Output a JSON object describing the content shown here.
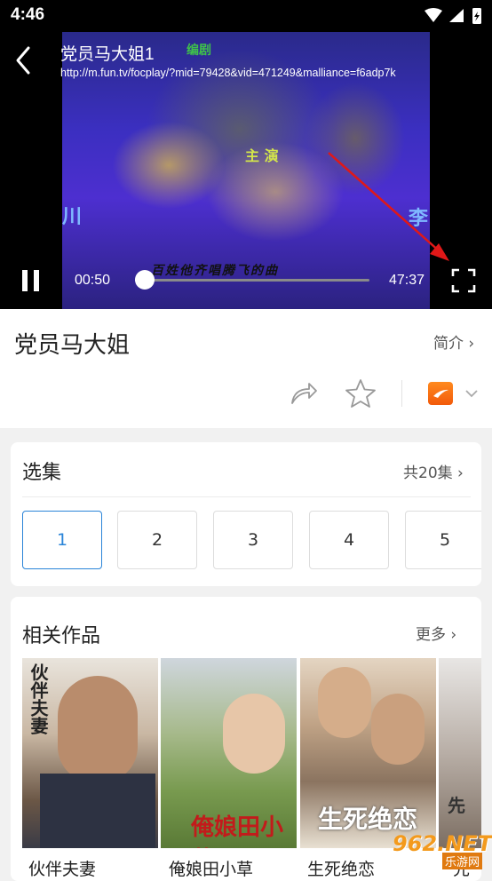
{
  "status": {
    "time": "4:46"
  },
  "player": {
    "title": "党员马大姐1",
    "url": "http://m.fun.tv/focplay/?mid=79428&vid=471249&malliance=f6adp7k",
    "current_time": "00:50",
    "total_time": "47:37",
    "progress_fraction": 0.018,
    "frame_texts": {
      "lead": "主 演",
      "subtitle": "百姓他齐唱腾飞的曲",
      "left_glyph": "川",
      "right_glyph": "李",
      "top_glyph": "编剧"
    }
  },
  "info": {
    "title": "党员马大姐",
    "intro_label": "简介 ›"
  },
  "episodes": {
    "label": "选集",
    "count_label": "共20集 ›",
    "items": [
      "1",
      "2",
      "3",
      "4",
      "5"
    ],
    "active_index": 0
  },
  "related": {
    "label": "相关作品",
    "more_label": "更多 ›",
    "items": [
      {
        "title": "伙伴夫妻",
        "poster_text": "伙伴夫妻"
      },
      {
        "title": "俺娘田小草",
        "poster_text": "俺娘田小草"
      },
      {
        "title": "生死绝恋",
        "poster_text": "生死绝恋"
      },
      {
        "title": "先",
        "poster_text": "先"
      }
    ]
  },
  "watermark": {
    "text": "962.NET",
    "sub": "乐游网"
  },
  "colors": {
    "accent": "#2a84d8",
    "source_orange": "#f56a12",
    "arrow_red": "#e01818"
  }
}
